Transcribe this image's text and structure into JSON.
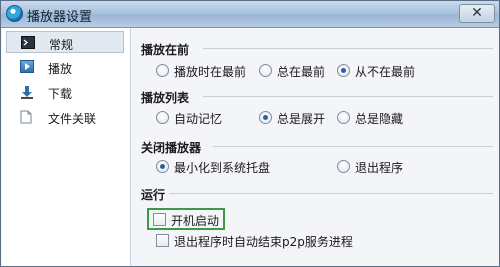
{
  "window": {
    "title": "播放器设置",
    "close_label": "✕"
  },
  "sidebar": {
    "items": [
      {
        "label": "常规",
        "icon": "terminal-icon"
      },
      {
        "label": "播放",
        "icon": "play-icon"
      },
      {
        "label": "下载",
        "icon": "download-icon"
      },
      {
        "label": "文件关联",
        "icon": "document-icon"
      }
    ]
  },
  "sections": {
    "playback_front": {
      "title": "播放在前",
      "options": [
        "播放时在最前",
        "总在最前",
        "从不在最前"
      ],
      "selected": "从不在最前"
    },
    "playlist": {
      "title": "播放列表",
      "options": [
        "自动记忆",
        "总是展开",
        "总是隐藏"
      ],
      "selected": "总是展开"
    },
    "close_player": {
      "title": "关闭播放器",
      "options": [
        "最小化到系统托盘",
        "退出程序"
      ],
      "selected": "最小化到系统托盘"
    },
    "run": {
      "title": "运行",
      "options": [
        "开机启动",
        "退出程序时自动结束p2p服务进程"
      ],
      "checked": [
        false,
        false
      ]
    }
  },
  "colors": {
    "highlight_border": "#3a9a4a",
    "radio_dot": "#2b5fa3",
    "titlebar": "#aac3de"
  }
}
